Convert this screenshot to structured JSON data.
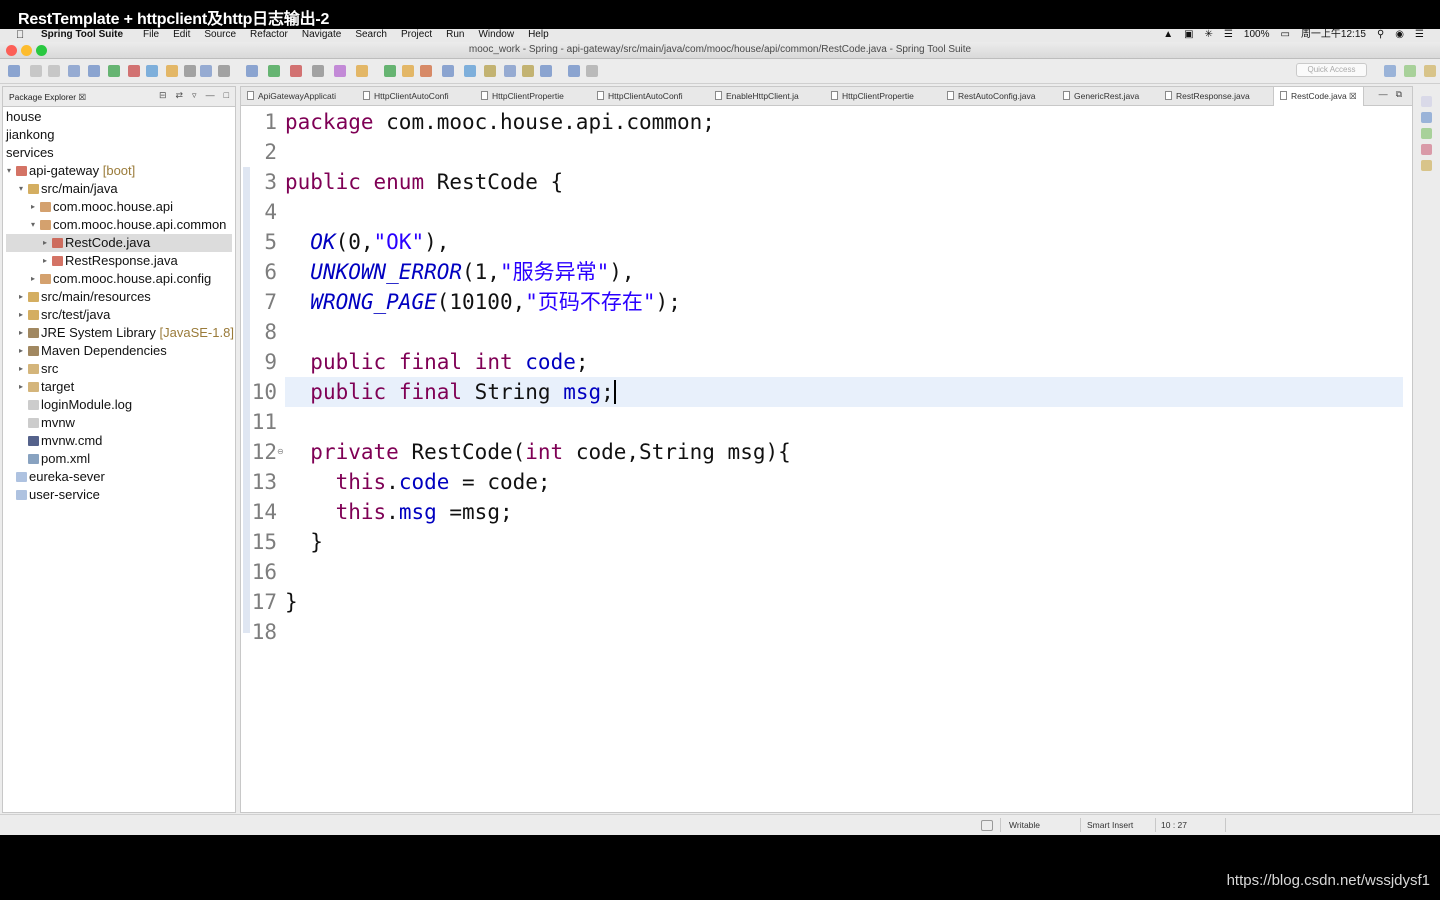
{
  "video_title": "RestTemplate + httpclient及http日志输出-2",
  "menubar": {
    "app_name": "Spring Tool Suite",
    "menus": [
      "File",
      "Edit",
      "Source",
      "Refactor",
      "Navigate",
      "Search",
      "Project",
      "Run",
      "Window",
      "Help"
    ],
    "battery": "100%",
    "clock": "周一上午12:15"
  },
  "window": {
    "title": "mooc_work - Spring - api-gateway/src/main/java/com/mooc/house/api/common/RestCode.java - Spring Tool Suite"
  },
  "toolbar": {
    "quick_access_placeholder": "Quick Access"
  },
  "package_explorer": {
    "title": "Package Explorer",
    "items": [
      {
        "label": "house",
        "decoration": "",
        "icon": "none",
        "expanded": null,
        "selected": false
      },
      {
        "label": "jiankong",
        "decoration": "",
        "icon": "none",
        "expanded": null,
        "selected": false
      },
      {
        "label": "services",
        "decoration": "",
        "icon": "none",
        "expanded": null,
        "selected": false
      },
      {
        "label": "api-gateway",
        "decoration": "[boot]",
        "icon": "project-icon",
        "expanded": true,
        "selected": false
      },
      {
        "label": "src/main/java",
        "decoration": "",
        "icon": "source-folder-icon",
        "expanded": true,
        "selected": false
      },
      {
        "label": "com.mooc.house.api",
        "decoration": "",
        "icon": "package-icon",
        "expanded": false,
        "selected": false
      },
      {
        "label": "com.mooc.house.api.common",
        "decoration": "",
        "icon": "package-icon",
        "expanded": true,
        "selected": false
      },
      {
        "label": "RestCode.java",
        "decoration": "",
        "icon": "java-file-icon",
        "expanded": false,
        "selected": true
      },
      {
        "label": "RestResponse.java",
        "decoration": "",
        "icon": "java-file-icon",
        "expanded": false,
        "selected": false
      },
      {
        "label": "com.mooc.house.api.config",
        "decoration": "",
        "icon": "package-icon",
        "expanded": false,
        "selected": false
      },
      {
        "label": "src/main/resources",
        "decoration": "",
        "icon": "source-folder-icon",
        "expanded": false,
        "selected": false
      },
      {
        "label": "src/test/java",
        "decoration": "",
        "icon": "source-folder-icon",
        "expanded": false,
        "selected": false
      },
      {
        "label": "JRE System Library",
        "decoration": "[JavaSE-1.8]",
        "icon": "library-icon",
        "expanded": false,
        "selected": false
      },
      {
        "label": "Maven Dependencies",
        "decoration": "",
        "icon": "library-icon",
        "expanded": false,
        "selected": false
      },
      {
        "label": "src",
        "decoration": "",
        "icon": "folder-icon",
        "expanded": false,
        "selected": false
      },
      {
        "label": "target",
        "decoration": "",
        "icon": "folder-icon",
        "expanded": false,
        "selected": false
      },
      {
        "label": "loginModule.log",
        "decoration": "",
        "icon": "file-icon",
        "expanded": null,
        "selected": false
      },
      {
        "label": "mvnw",
        "decoration": "",
        "icon": "file-icon",
        "expanded": null,
        "selected": false
      },
      {
        "label": "mvnw.cmd",
        "decoration": "",
        "icon": "cmd-file-icon",
        "expanded": null,
        "selected": false
      },
      {
        "label": "pom.xml",
        "decoration": "",
        "icon": "xml-file-icon",
        "expanded": null,
        "selected": false
      },
      {
        "label": "eureka-sever",
        "decoration": "",
        "icon": "project-closed-icon",
        "expanded": null,
        "selected": false
      },
      {
        "label": "user-service",
        "decoration": "",
        "icon": "project-closed-icon",
        "expanded": null,
        "selected": false
      }
    ]
  },
  "editor_tabs": [
    {
      "label": "ApiGatewayApplicati",
      "active": false
    },
    {
      "label": "HttpClientAutoConfi",
      "active": false
    },
    {
      "label": "HttpClientPropertie",
      "active": false
    },
    {
      "label": "HttpClientAutoConfi",
      "active": false
    },
    {
      "label": "EnableHttpClient.ja",
      "active": false
    },
    {
      "label": "HttpClientPropertie",
      "active": false
    },
    {
      "label": "RestAutoConfig.java",
      "active": false
    },
    {
      "label": "GenericRest.java",
      "active": false
    },
    {
      "label": "RestResponse.java",
      "active": false
    },
    {
      "label": "RestCode.java",
      "active": true
    }
  ],
  "code": {
    "line_numbers": [
      "1",
      "2",
      "3",
      "4",
      "5",
      "6",
      "7",
      "8",
      "9",
      "10",
      "11",
      "12",
      "13",
      "14",
      "15",
      "16",
      "17",
      "18"
    ],
    "lines": [
      [
        {
          "t": "package",
          "c": "kw"
        },
        {
          "t": " com.mooc.house.api.common;",
          "c": ""
        }
      ],
      [],
      [
        {
          "t": "public",
          "c": "kw"
        },
        {
          "t": " ",
          "c": ""
        },
        {
          "t": "enum",
          "c": "kw"
        },
        {
          "t": " RestCode {",
          "c": ""
        }
      ],
      [],
      [
        {
          "t": "  ",
          "c": ""
        },
        {
          "t": "OK",
          "c": "enm"
        },
        {
          "t": "(0,",
          "c": ""
        },
        {
          "t": "\"OK\"",
          "c": "str"
        },
        {
          "t": "),",
          "c": ""
        }
      ],
      [
        {
          "t": "  ",
          "c": ""
        },
        {
          "t": "UNKOWN_ERROR",
          "c": "enm"
        },
        {
          "t": "(1,",
          "c": ""
        },
        {
          "t": "\"服务异常\"",
          "c": "str"
        },
        {
          "t": "),",
          "c": ""
        }
      ],
      [
        {
          "t": "  ",
          "c": ""
        },
        {
          "t": "WRONG_PAGE",
          "c": "enm"
        },
        {
          "t": "(10100,",
          "c": ""
        },
        {
          "t": "\"页码不存在\"",
          "c": "str"
        },
        {
          "t": ");",
          "c": ""
        }
      ],
      [],
      [
        {
          "t": "  ",
          "c": ""
        },
        {
          "t": "public",
          "c": "kw"
        },
        {
          "t": " ",
          "c": ""
        },
        {
          "t": "final",
          "c": "kw"
        },
        {
          "t": " ",
          "c": ""
        },
        {
          "t": "int",
          "c": "kw"
        },
        {
          "t": " ",
          "c": ""
        },
        {
          "t": "code",
          "c": "fld"
        },
        {
          "t": ";",
          "c": ""
        }
      ],
      [
        {
          "t": "  ",
          "c": ""
        },
        {
          "t": "public",
          "c": "kw"
        },
        {
          "t": " ",
          "c": ""
        },
        {
          "t": "final",
          "c": "kw"
        },
        {
          "t": " String ",
          "c": ""
        },
        {
          "t": "msg",
          "c": "fld"
        },
        {
          "t": ";",
          "c": ""
        }
      ],
      [],
      [
        {
          "t": "  ",
          "c": ""
        },
        {
          "t": "private",
          "c": "kw"
        },
        {
          "t": " RestCode(",
          "c": ""
        },
        {
          "t": "int",
          "c": "kw"
        },
        {
          "t": " code,String msg){",
          "c": ""
        }
      ],
      [
        {
          "t": "    ",
          "c": ""
        },
        {
          "t": "this",
          "c": "kw"
        },
        {
          "t": ".",
          "c": ""
        },
        {
          "t": "code",
          "c": "fld"
        },
        {
          "t": " = code;",
          "c": ""
        }
      ],
      [
        {
          "t": "    ",
          "c": ""
        },
        {
          "t": "this",
          "c": "kw"
        },
        {
          "t": ".",
          "c": ""
        },
        {
          "t": "msg",
          "c": "fld"
        },
        {
          "t": " =msg;",
          "c": ""
        }
      ],
      [
        {
          "t": "  }",
          "c": ""
        }
      ],
      [],
      [
        {
          "t": "}",
          "c": ""
        }
      ],
      []
    ],
    "current_line": 10
  },
  "statusbar": {
    "writable": "Writable",
    "insert_mode": "Smart Insert",
    "cursor_position": "10 : 27"
  },
  "watermark": "https://blog.csdn.net/wssjdysf1",
  "colors": {
    "keyword": "#7f0055",
    "field": "#0000c0",
    "string": "#2a00ff",
    "current_line": "#e8f0fb"
  }
}
